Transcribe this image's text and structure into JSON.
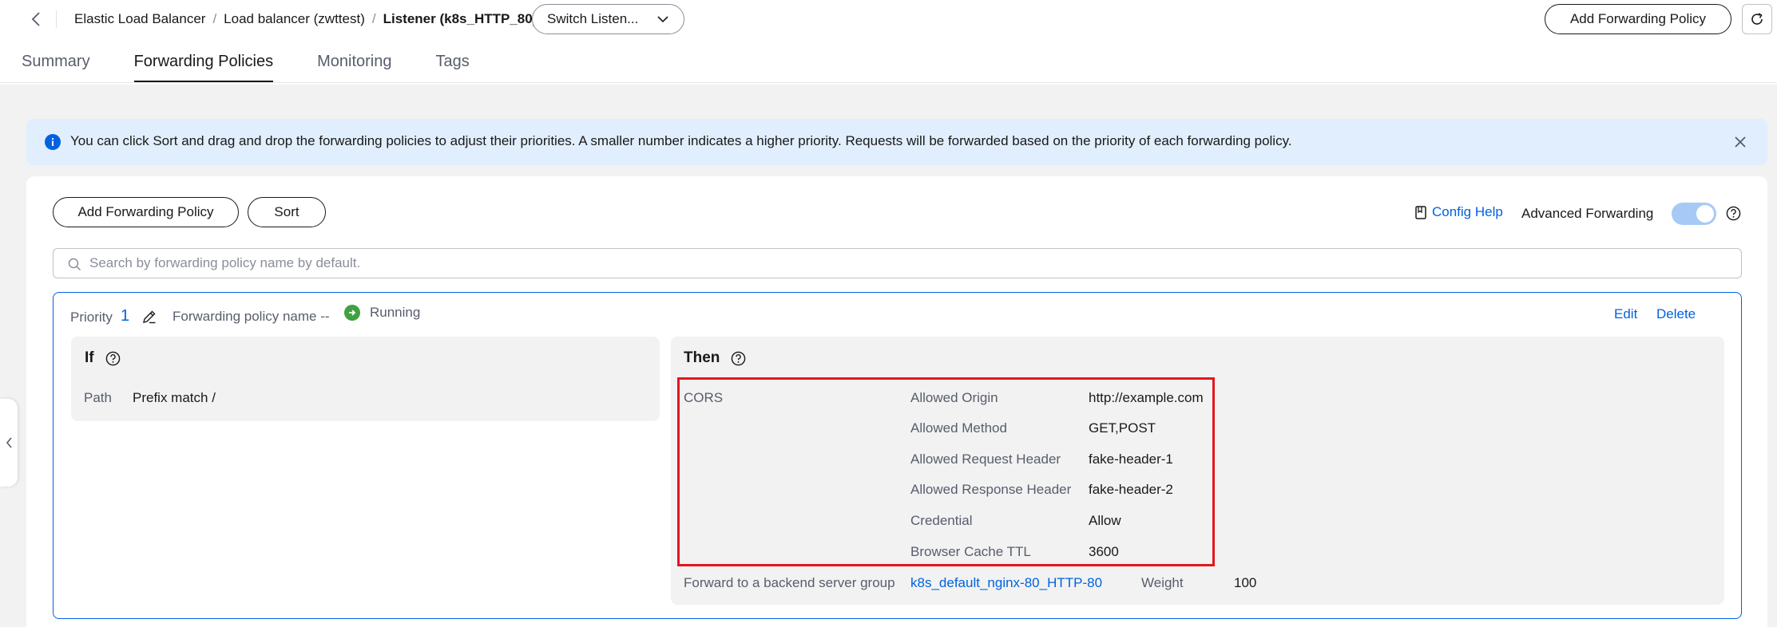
{
  "breadcrumb": {
    "items": [
      "Elastic Load Balancer",
      "Load balancer (zwttest)"
    ],
    "current": "Listener (k8s_HTTP_80)",
    "separator": "/"
  },
  "switch_listener": {
    "label": "Switch Listen..."
  },
  "header": {
    "add_policy_label": "Add Forwarding Policy"
  },
  "tabs": [
    {
      "label": "Summary",
      "active": false
    },
    {
      "label": "Forwarding Policies",
      "active": true
    },
    {
      "label": "Monitoring",
      "active": false
    },
    {
      "label": "Tags",
      "active": false
    }
  ],
  "banner": {
    "text": "You can click Sort and drag and drop the forwarding policies to adjust their priorities. A smaller number indicates a higher priority. Requests will be forwarded based on the priority of each forwarding policy."
  },
  "toolbar": {
    "add_label": "Add Forwarding Policy",
    "sort_label": "Sort",
    "config_help": "Config Help",
    "advanced_forwarding": "Advanced Forwarding",
    "advanced_enabled": true
  },
  "search": {
    "placeholder": "Search by forwarding policy name by default."
  },
  "policy": {
    "priority_label": "Priority",
    "priority": "1",
    "name_label": "Forwarding policy name --",
    "status": "Running",
    "edit": "Edit",
    "delete": "Delete",
    "if": {
      "title": "If",
      "path_label": "Path",
      "path_value": "Prefix match /"
    },
    "then": {
      "title": "Then",
      "cors_label": "CORS",
      "cors": [
        {
          "key": "Allowed Origin",
          "value": "http://example.com"
        },
        {
          "key": "Allowed Method",
          "value": "GET,POST"
        },
        {
          "key": "Allowed Request Header",
          "value": "fake-header-1"
        },
        {
          "key": "Allowed Response Header",
          "value": "fake-header-2"
        },
        {
          "key": "Credential",
          "value": "Allow"
        },
        {
          "key": "Browser Cache TTL",
          "value": "3600"
        }
      ],
      "forward_label": "Forward to a backend server group",
      "forward_target": "k8s_default_nginx-80_HTTP-80",
      "weight_label": "Weight",
      "weight": "100"
    }
  },
  "colors": {
    "accent": "#0062e0",
    "banner_bg": "#e1eefd",
    "status_running": "#3fa13f",
    "highlight": "#e5161d"
  }
}
